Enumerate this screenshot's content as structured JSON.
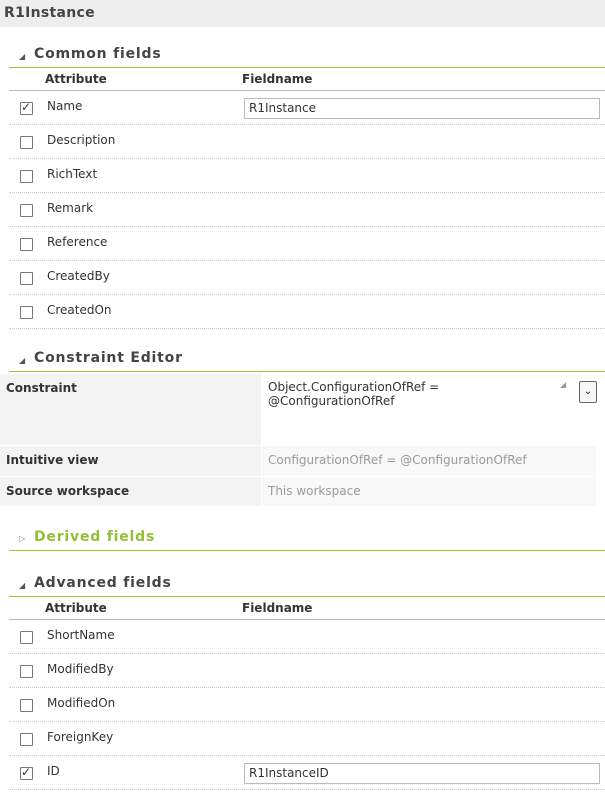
{
  "window": {
    "title": "R1Instance"
  },
  "common": {
    "title": "Common fields",
    "col_attribute": "Attribute",
    "col_fieldname": "Fieldname",
    "rows": [
      {
        "label": "Name",
        "checked": true,
        "value": "R1Instance"
      },
      {
        "label": "Description",
        "checked": false
      },
      {
        "label": "RichText",
        "checked": false
      },
      {
        "label": "Remark",
        "checked": false
      },
      {
        "label": "Reference",
        "checked": false
      },
      {
        "label": "CreatedBy",
        "checked": false
      },
      {
        "label": "CreatedOn",
        "checked": false
      }
    ]
  },
  "constraint": {
    "title": "Constraint Editor",
    "constraint_label": "Constraint",
    "constraint_value": "Object.ConfigurationOfRef = @ConfigurationOfRef",
    "intuitive_label": "Intuitive view",
    "intuitive_value": "ConfigurationOfRef = @ConfigurationOfRef",
    "source_label": "Source workspace",
    "source_value": "This workspace"
  },
  "derived": {
    "title": "Derived fields",
    "expanded": false
  },
  "advanced": {
    "title": "Advanced fields",
    "col_attribute": "Attribute",
    "col_fieldname": "Fieldname",
    "rows": [
      {
        "label": "ShortName",
        "checked": false
      },
      {
        "label": "ModifiedBy",
        "checked": false
      },
      {
        "label": "ModifiedOn",
        "checked": false
      },
      {
        "label": "ForeignKey",
        "checked": false
      },
      {
        "label": "ID",
        "checked": true,
        "value": "R1InstanceID"
      }
    ]
  },
  "colors": {
    "accent": "#93bf35",
    "header_bg": "#eeeeee"
  },
  "icons": {
    "expanded": "triangle-expanded-icon",
    "collapsed": "triangle-collapsed-icon",
    "dropdown": "chevron-down-icon"
  }
}
